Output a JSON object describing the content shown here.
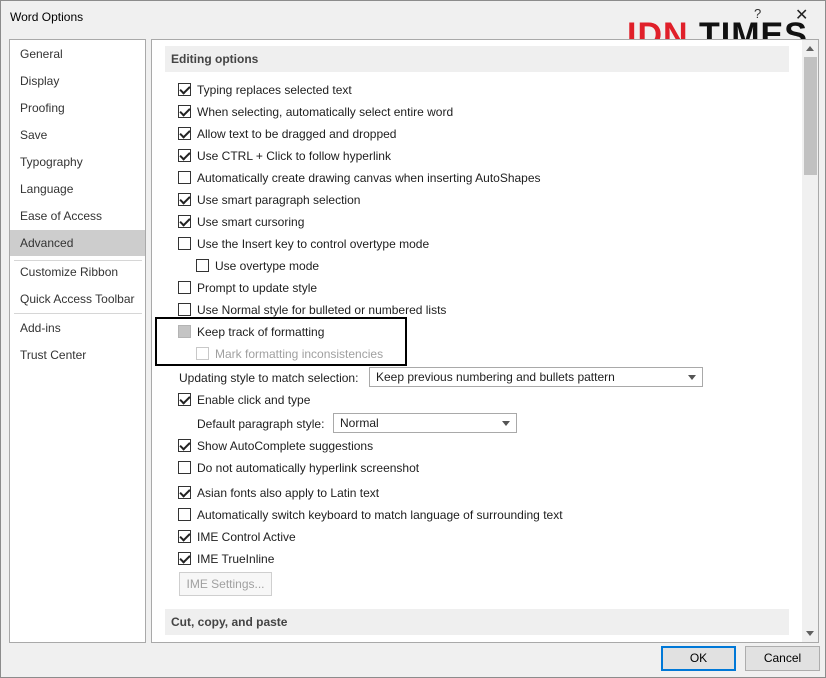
{
  "window": {
    "title": "Word Options",
    "help": "?",
    "close": "✕"
  },
  "watermark": {
    "red": "IDN",
    "black": " TIMES"
  },
  "sidebar": {
    "items": [
      {
        "label": "General"
      },
      {
        "label": "Display"
      },
      {
        "label": "Proofing"
      },
      {
        "label": "Save"
      },
      {
        "label": "Typography"
      },
      {
        "label": "Language"
      },
      {
        "label": "Ease of Access"
      },
      {
        "label": "Advanced",
        "active": true
      },
      {
        "label": "Customize Ribbon"
      },
      {
        "label": "Quick Access Toolbar"
      },
      {
        "label": "Add-ins"
      },
      {
        "label": "Trust Center"
      }
    ]
  },
  "editing": {
    "header": "Editing options",
    "opt1": "Typing replaces selected text",
    "opt2": "When selecting, automatically select entire word",
    "opt3": "Allow text to be dragged and dropped",
    "opt4": "Use CTRL + Click to follow hyperlink",
    "opt5": "Automatically create drawing canvas when inserting AutoShapes",
    "opt6": "Use smart paragraph selection",
    "opt7": "Use smart cursoring",
    "opt8": "Use the Insert key to control overtype mode",
    "opt9": "Use overtype mode",
    "opt10": "Prompt to update style",
    "opt11": "Use Normal style for bulleted or numbered lists",
    "opt12": "Keep track of formatting",
    "opt13": "Mark formatting inconsistencies",
    "updating_label": "Updating style to match selection:",
    "updating_value": "Keep previous numbering and bullets pattern",
    "opt14": "Enable click and type",
    "default_para_label": "Default paragraph style:",
    "default_para_value": "Normal",
    "opt15": "Show AutoComplete suggestions",
    "opt16": "Do not automatically hyperlink screenshot",
    "opt17": "Asian fonts also apply to Latin text",
    "opt18": "Automatically switch keyboard to match language of surrounding text",
    "opt19": "IME Control Active",
    "opt20": "IME TrueInline",
    "ime_settings": "IME Settings..."
  },
  "cutcopy": {
    "header": "Cut, copy, and paste"
  },
  "footer": {
    "ok": "OK",
    "cancel": "Cancel"
  }
}
